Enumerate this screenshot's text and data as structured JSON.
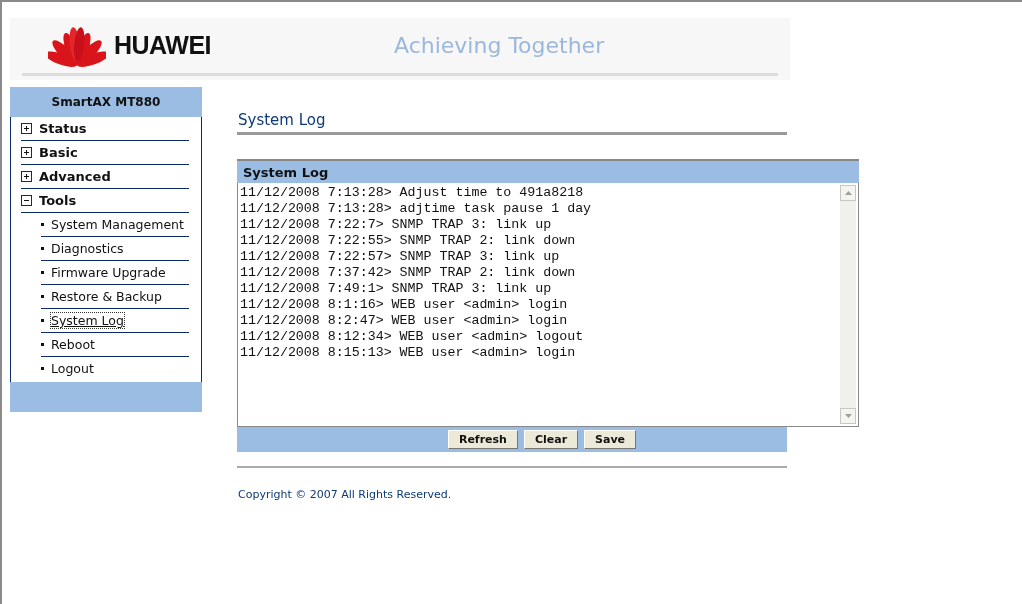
{
  "header": {
    "brand": "HUAWEI",
    "slogan": "Achieving Together"
  },
  "sidebar": {
    "title": "SmartAX MT880",
    "items": [
      {
        "label": "Status",
        "expanded": false
      },
      {
        "label": "Basic",
        "expanded": false
      },
      {
        "label": "Advanced",
        "expanded": false
      },
      {
        "label": "Tools",
        "expanded": true,
        "children": [
          {
            "label": "System Management",
            "selected": false
          },
          {
            "label": "Diagnostics",
            "selected": false
          },
          {
            "label": "Firmware Upgrade",
            "selected": false
          },
          {
            "label": "Restore & Backup",
            "selected": false
          },
          {
            "label": "System Log",
            "selected": true
          },
          {
            "label": "Reboot",
            "selected": false
          },
          {
            "label": "Logout",
            "selected": false
          }
        ]
      }
    ]
  },
  "page_title": "System Log",
  "log_panel": {
    "title": "System Log",
    "lines": [
      "11/12/2008 7:13:28> Adjust time to 491a8218",
      "11/12/2008 7:13:28> adjtime task pause 1 day",
      "11/12/2008 7:22:7> SNMP TRAP 3: link up",
      "11/12/2008 7:22:55> SNMP TRAP 2: link down",
      "11/12/2008 7:22:57> SNMP TRAP 3: link up",
      "11/12/2008 7:37:42> SNMP TRAP 2: link down",
      "11/12/2008 7:49:1> SNMP TRAP 3: link up",
      "11/12/2008 8:1:16> WEB user <admin> login",
      "11/12/2008 8:2:47> WEB user <admin> login",
      "11/12/2008 8:12:34> WEB user <admin> logout",
      "11/12/2008 8:15:13> WEB user <admin> login"
    ],
    "buttons": [
      "Refresh",
      "Clear",
      "Save"
    ]
  },
  "footer": "Copyright © 2007 All Rights Reserved."
}
